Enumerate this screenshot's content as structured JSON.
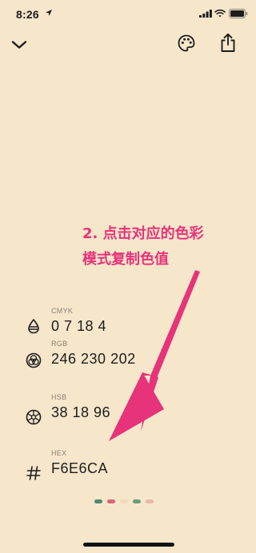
{
  "status_bar": {
    "time": "8:26"
  },
  "annotation": {
    "line1": "2. 点击对应的色彩",
    "line2": "模式复制色值",
    "color": "#E6337A"
  },
  "color_modes": [
    {
      "label": "CMYK",
      "value": "0 7 18 4",
      "icon": "cmyk-drop-icon"
    },
    {
      "label": "RGB",
      "value": "246 230 202",
      "icon": "rgb-circles-icon"
    },
    {
      "label": "HSB",
      "value": "38 18 96",
      "icon": "hsb-wheel-icon"
    },
    {
      "label": "HEX",
      "value": "F6E6CA",
      "icon": "hash-icon"
    }
  ],
  "background_color": "#F6E6CA",
  "page_dots": [
    "#4E8A6E",
    "#D9657A",
    "#F4D8C0",
    "#67A07E",
    "#E8B8A4"
  ],
  "active_page": 3
}
